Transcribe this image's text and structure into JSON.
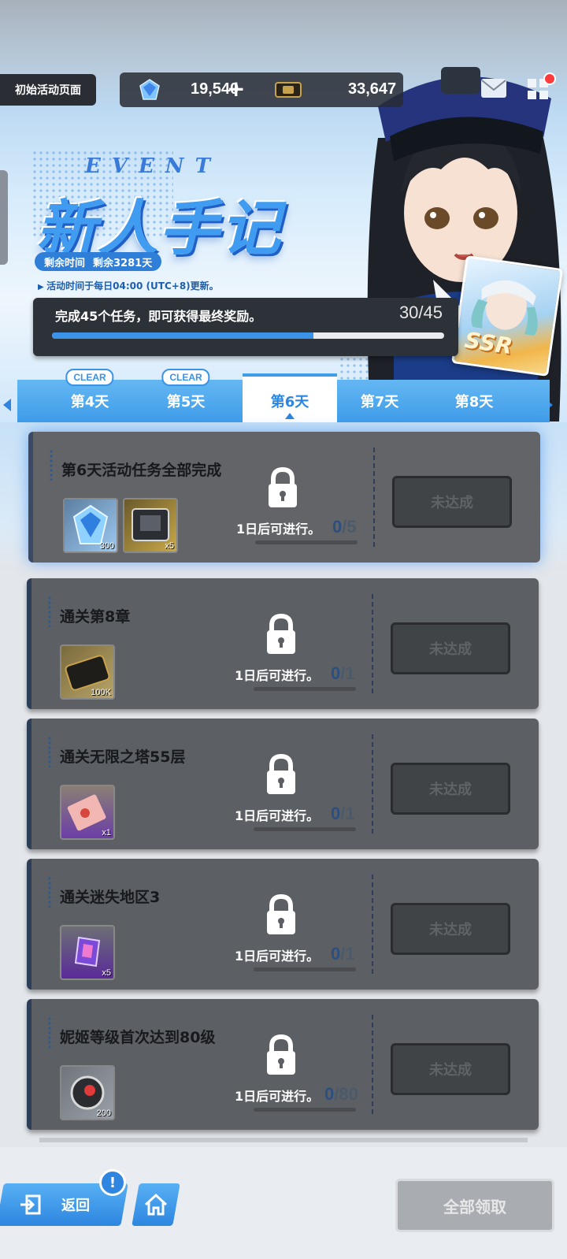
{
  "header": {
    "page_title": "初始活动页面",
    "gems": "19,540",
    "gems_plus": "+",
    "credits": "33,647"
  },
  "event": {
    "event_word": "EVENT",
    "title": "新人手记",
    "time_label": "剩余时间",
    "time_value": "剩余3281天",
    "update_note": "活动时间于每日04:00 (UTC+8)更新。",
    "progress_text": "完成45个任务，即可获得最终奖励。",
    "progress_count": "30/45",
    "progress_done": 30,
    "progress_total": 45,
    "card_badge": "SSR"
  },
  "tabs": [
    {
      "label": "第4天",
      "badge": "CLEAR"
    },
    {
      "label": "第5天",
      "badge": "CLEAR"
    },
    {
      "label": "第6天",
      "badge": "",
      "active": true
    },
    {
      "label": "第7天",
      "badge": ""
    },
    {
      "label": "第8天",
      "badge": ""
    }
  ],
  "missions": [
    {
      "title": "第6天活动任务全部完成",
      "lock_text": "1日后可进行。",
      "done": "0",
      "total": "/5",
      "button": "未达成",
      "rewards": [
        {
          "icon": "gem-icon",
          "qty": "300"
        },
        {
          "icon": "gear-box-icon",
          "qty": "x5"
        }
      ]
    },
    {
      "title": "通关第8章",
      "lock_text": "1日后可进行。",
      "done": "0",
      "total": "/1",
      "button": "未达成",
      "rewards": [
        {
          "icon": "credit-case-icon",
          "qty": "100K"
        }
      ]
    },
    {
      "title": "通关无限之塔55层",
      "lock_text": "1日后可进行。",
      "done": "0",
      "total": "/1",
      "button": "未达成",
      "rewards": [
        {
          "icon": "ticket-icon",
          "qty": "x1"
        }
      ]
    },
    {
      "title": "通关迷失地区3",
      "lock_text": "1日后可进行。",
      "done": "0",
      "total": "/1",
      "button": "未达成",
      "rewards": [
        {
          "icon": "crystal-icon",
          "qty": "x5"
        }
      ]
    },
    {
      "title": "妮姬等级首次达到80级",
      "lock_text": "1日后可进行。",
      "done": "0",
      "total": "/80",
      "button": "未达成",
      "rewards": [
        {
          "icon": "core-orb-icon",
          "qty": "200"
        }
      ]
    }
  ],
  "footer": {
    "back_label": "返回",
    "alert": "!",
    "claim_all": "全部领取"
  },
  "colors": {
    "accent": "#3a93e6",
    "card": "#5c5f63",
    "dark": "#2d3138"
  }
}
